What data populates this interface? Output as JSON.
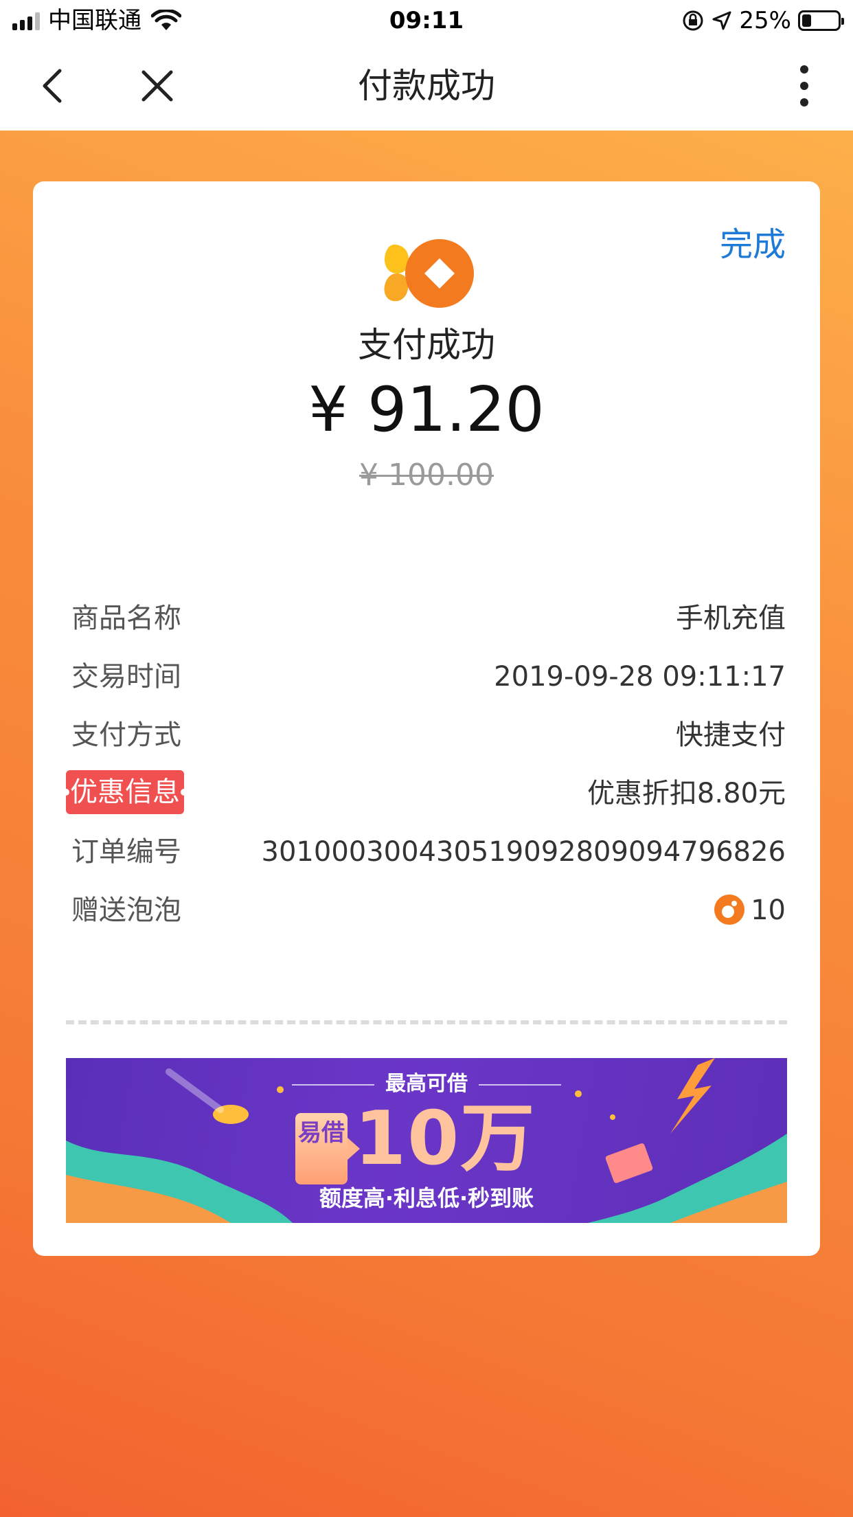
{
  "status_bar": {
    "carrier": "中国联通",
    "time": "09:11",
    "battery_percent": "25%",
    "battery_level": 0.25
  },
  "nav": {
    "title": "付款成功"
  },
  "card": {
    "done_label": "完成",
    "status_text": "支付成功",
    "amount": "¥ 91.20",
    "original_amount": "¥ 100.00",
    "details": [
      {
        "label": "商品名称",
        "value": "手机充值"
      },
      {
        "label": "交易时间",
        "value": "2019-09-28 09:11:17"
      },
      {
        "label": "支付方式",
        "value": "快捷支付"
      },
      {
        "label": "优惠信息",
        "value": "优惠折扣8.80元"
      },
      {
        "label": "订单编号",
        "value": "301000300430519092809094796826"
      },
      {
        "label": "赠送泡泡",
        "value": "10"
      }
    ]
  },
  "banner": {
    "top_text": "最高可借",
    "logo_text": "易借",
    "big_text": "10万",
    "sub_text": "额度高·利息低·秒到账"
  },
  "colors": {
    "accent_blue": "#1e7ad6",
    "brand_orange": "#f57a35",
    "highlight_red": "#f05050",
    "banner_purple": "#6b36c8"
  },
  "icons": [
    "signal-icon",
    "wifi-icon",
    "rotation-lock-icon",
    "location-arrow-icon",
    "battery-icon",
    "back-chevron-icon",
    "close-icon",
    "more-vertical-icon",
    "brand-logo-icon",
    "bubble-icon"
  ]
}
